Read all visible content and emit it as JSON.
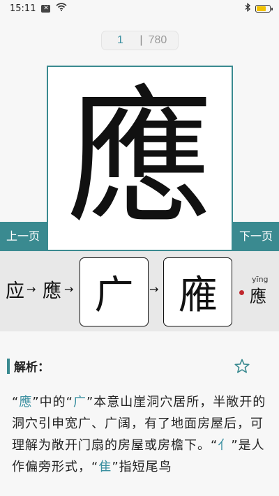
{
  "status_bar": {
    "time": "15:11",
    "notif_glyph": "✕"
  },
  "counter": {
    "current": "1",
    "separator": "|",
    "total": "780"
  },
  "character": {
    "main": "應"
  },
  "nav": {
    "prev": "上一页",
    "next": "下一页"
  },
  "evolution": {
    "simplified": "应",
    "traditional": "應",
    "arrow": "→",
    "stage1_glyph": "广",
    "stage2_glyph": "䧹",
    "pinyin": "yīng",
    "small_glyph": "應"
  },
  "analysis": {
    "title": "解析：",
    "q1": "“",
    "w1": "應",
    "t1": "”中的“",
    "w2": "广",
    "t2": "”本意山崖洞穴居所，半敞开的洞穴引申宽广、广阔，有了地面房屋后，可理解为敞开门扇的房屋或房檐下。“",
    "w3": "亻",
    "t3": "”是人作偏旁形式，“",
    "w4": "隹",
    "t4": "”指短尾鸟"
  },
  "colors": {
    "accent": "#3a8a90",
    "highlight": "#3a8fa0",
    "dot": "#c0272d"
  },
  "icons": [
    "close-box-icon",
    "wifi-icon",
    "bluetooth-icon",
    "battery-icon",
    "star-icon"
  ]
}
